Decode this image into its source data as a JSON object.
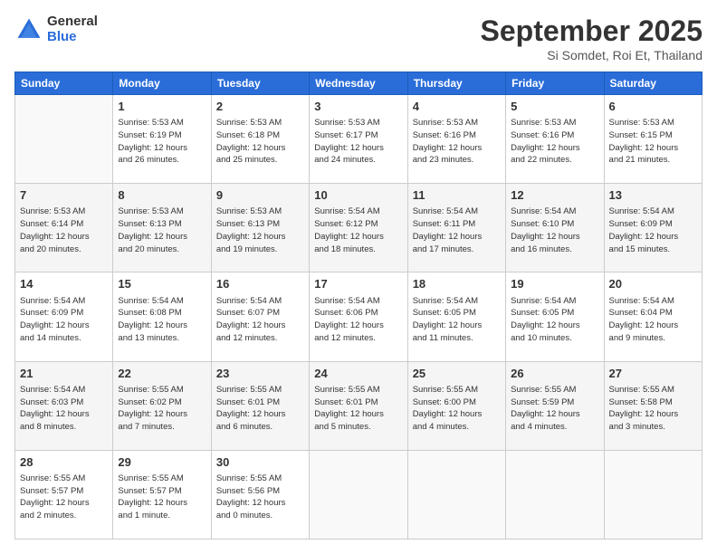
{
  "logo": {
    "general": "General",
    "blue": "Blue"
  },
  "header": {
    "title": "September 2025",
    "subtitle": "Si Somdet, Roi Et, Thailand"
  },
  "days_of_week": [
    "Sunday",
    "Monday",
    "Tuesday",
    "Wednesday",
    "Thursday",
    "Friday",
    "Saturday"
  ],
  "weeks": [
    [
      {
        "day": "",
        "info": ""
      },
      {
        "day": "1",
        "info": "Sunrise: 5:53 AM\nSunset: 6:19 PM\nDaylight: 12 hours\nand 26 minutes."
      },
      {
        "day": "2",
        "info": "Sunrise: 5:53 AM\nSunset: 6:18 PM\nDaylight: 12 hours\nand 25 minutes."
      },
      {
        "day": "3",
        "info": "Sunrise: 5:53 AM\nSunset: 6:17 PM\nDaylight: 12 hours\nand 24 minutes."
      },
      {
        "day": "4",
        "info": "Sunrise: 5:53 AM\nSunset: 6:16 PM\nDaylight: 12 hours\nand 23 minutes."
      },
      {
        "day": "5",
        "info": "Sunrise: 5:53 AM\nSunset: 6:16 PM\nDaylight: 12 hours\nand 22 minutes."
      },
      {
        "day": "6",
        "info": "Sunrise: 5:53 AM\nSunset: 6:15 PM\nDaylight: 12 hours\nand 21 minutes."
      }
    ],
    [
      {
        "day": "7",
        "info": "Sunrise: 5:53 AM\nSunset: 6:14 PM\nDaylight: 12 hours\nand 20 minutes."
      },
      {
        "day": "8",
        "info": "Sunrise: 5:53 AM\nSunset: 6:13 PM\nDaylight: 12 hours\nand 20 minutes."
      },
      {
        "day": "9",
        "info": "Sunrise: 5:53 AM\nSunset: 6:13 PM\nDaylight: 12 hours\nand 19 minutes."
      },
      {
        "day": "10",
        "info": "Sunrise: 5:54 AM\nSunset: 6:12 PM\nDaylight: 12 hours\nand 18 minutes."
      },
      {
        "day": "11",
        "info": "Sunrise: 5:54 AM\nSunset: 6:11 PM\nDaylight: 12 hours\nand 17 minutes."
      },
      {
        "day": "12",
        "info": "Sunrise: 5:54 AM\nSunset: 6:10 PM\nDaylight: 12 hours\nand 16 minutes."
      },
      {
        "day": "13",
        "info": "Sunrise: 5:54 AM\nSunset: 6:09 PM\nDaylight: 12 hours\nand 15 minutes."
      }
    ],
    [
      {
        "day": "14",
        "info": "Sunrise: 5:54 AM\nSunset: 6:09 PM\nDaylight: 12 hours\nand 14 minutes."
      },
      {
        "day": "15",
        "info": "Sunrise: 5:54 AM\nSunset: 6:08 PM\nDaylight: 12 hours\nand 13 minutes."
      },
      {
        "day": "16",
        "info": "Sunrise: 5:54 AM\nSunset: 6:07 PM\nDaylight: 12 hours\nand 12 minutes."
      },
      {
        "day": "17",
        "info": "Sunrise: 5:54 AM\nSunset: 6:06 PM\nDaylight: 12 hours\nand 12 minutes."
      },
      {
        "day": "18",
        "info": "Sunrise: 5:54 AM\nSunset: 6:05 PM\nDaylight: 12 hours\nand 11 minutes."
      },
      {
        "day": "19",
        "info": "Sunrise: 5:54 AM\nSunset: 6:05 PM\nDaylight: 12 hours\nand 10 minutes."
      },
      {
        "day": "20",
        "info": "Sunrise: 5:54 AM\nSunset: 6:04 PM\nDaylight: 12 hours\nand 9 minutes."
      }
    ],
    [
      {
        "day": "21",
        "info": "Sunrise: 5:54 AM\nSunset: 6:03 PM\nDaylight: 12 hours\nand 8 minutes."
      },
      {
        "day": "22",
        "info": "Sunrise: 5:55 AM\nSunset: 6:02 PM\nDaylight: 12 hours\nand 7 minutes."
      },
      {
        "day": "23",
        "info": "Sunrise: 5:55 AM\nSunset: 6:01 PM\nDaylight: 12 hours\nand 6 minutes."
      },
      {
        "day": "24",
        "info": "Sunrise: 5:55 AM\nSunset: 6:01 PM\nDaylight: 12 hours\nand 5 minutes."
      },
      {
        "day": "25",
        "info": "Sunrise: 5:55 AM\nSunset: 6:00 PM\nDaylight: 12 hours\nand 4 minutes."
      },
      {
        "day": "26",
        "info": "Sunrise: 5:55 AM\nSunset: 5:59 PM\nDaylight: 12 hours\nand 4 minutes."
      },
      {
        "day": "27",
        "info": "Sunrise: 5:55 AM\nSunset: 5:58 PM\nDaylight: 12 hours\nand 3 minutes."
      }
    ],
    [
      {
        "day": "28",
        "info": "Sunrise: 5:55 AM\nSunset: 5:57 PM\nDaylight: 12 hours\nand 2 minutes."
      },
      {
        "day": "29",
        "info": "Sunrise: 5:55 AM\nSunset: 5:57 PM\nDaylight: 12 hours\nand 1 minute."
      },
      {
        "day": "30",
        "info": "Sunrise: 5:55 AM\nSunset: 5:56 PM\nDaylight: 12 hours\nand 0 minutes."
      },
      {
        "day": "",
        "info": ""
      },
      {
        "day": "",
        "info": ""
      },
      {
        "day": "",
        "info": ""
      },
      {
        "day": "",
        "info": ""
      }
    ]
  ]
}
